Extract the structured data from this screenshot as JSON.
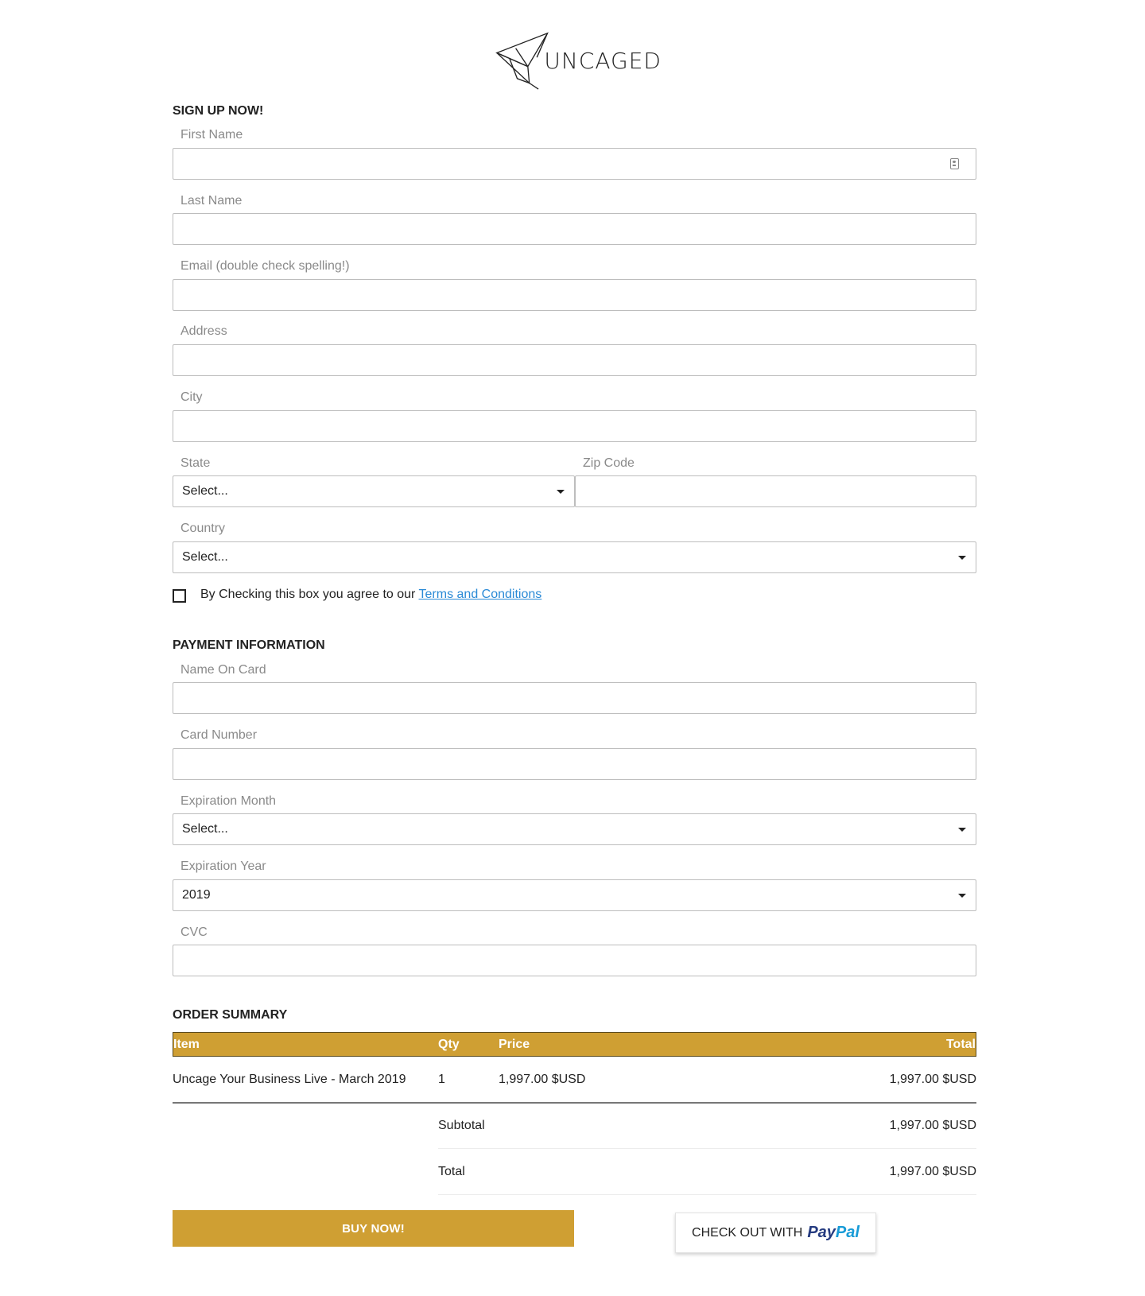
{
  "brand": {
    "name": "UNCAGED"
  },
  "signup": {
    "title": "SIGN UP NOW!",
    "first_name_label": "First Name",
    "last_name_label": "Last Name",
    "email_label": "Email (double check spelling!)",
    "address_label": "Address",
    "city_label": "City",
    "state_label": "State",
    "state_value": "Select...",
    "zip_label": "Zip Code",
    "country_label": "Country",
    "country_value": "Select...",
    "agree_text": "By Checking this box you agree to our ",
    "terms_link": "Terms and Conditions"
  },
  "payment": {
    "title": "PAYMENT INFORMATION",
    "name_on_card_label": "Name On Card",
    "card_number_label": "Card Number",
    "exp_month_label": "Expiration Month",
    "exp_month_value": "Select...",
    "exp_year_label": "Expiration Year",
    "exp_year_value": "2019",
    "cvc_label": "CVC"
  },
  "order": {
    "title": "ORDER SUMMARY",
    "headers": {
      "item": "Item",
      "qty": "Qty",
      "price": "Price",
      "total": "Total"
    },
    "rows": [
      {
        "item": "Uncage Your Business Live - March 2019",
        "qty": "1",
        "price": "1,997.00 $USD",
        "total": "1,997.00 $USD"
      }
    ],
    "subtotal_label": "Subtotal",
    "subtotal_value": "1,997.00 $USD",
    "total_label": "Total",
    "total_value": "1,997.00 $USD"
  },
  "actions": {
    "buy_label": "BUY NOW!",
    "paypal_label": "CHECK OUT WITH",
    "paypal_brand_1": "Pay",
    "paypal_brand_2": "Pal"
  },
  "colors": {
    "accent": "#cf9f33",
    "link": "#2a8ad6",
    "label": "#8a8a8a"
  }
}
